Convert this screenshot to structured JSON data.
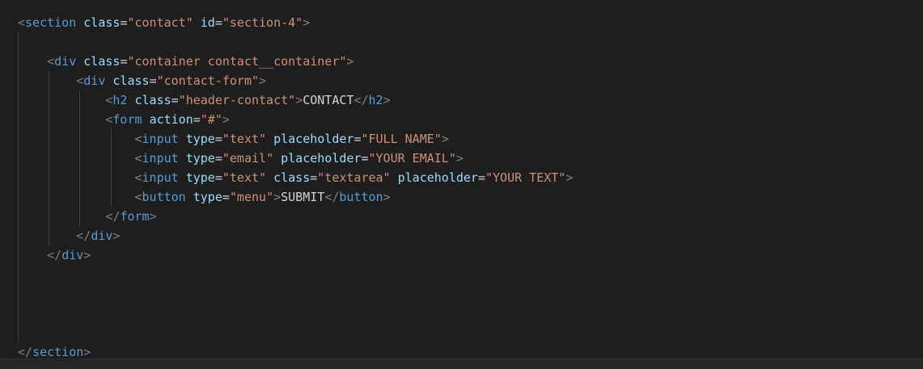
{
  "editor": {
    "lines": [
      [
        {
          "text": "<",
          "type": "punct"
        },
        {
          "text": "section",
          "type": "tag"
        },
        {
          "text": " ",
          "type": "text"
        },
        {
          "text": "class",
          "type": "attr"
        },
        {
          "text": "=",
          "type": "eq"
        },
        {
          "text": "\"contact\"",
          "type": "str"
        },
        {
          "text": " ",
          "type": "text"
        },
        {
          "text": "id",
          "type": "attr"
        },
        {
          "text": "=",
          "type": "eq"
        },
        {
          "text": "\"section-4\"",
          "type": "str"
        },
        {
          "text": ">",
          "type": "punct"
        }
      ],
      [],
      [
        {
          "text": "    ",
          "type": "text"
        },
        {
          "text": "<",
          "type": "punct"
        },
        {
          "text": "div",
          "type": "tag"
        },
        {
          "text": " ",
          "type": "text"
        },
        {
          "text": "class",
          "type": "attr"
        },
        {
          "text": "=",
          "type": "eq"
        },
        {
          "text": "\"container contact__container\"",
          "type": "str"
        },
        {
          "text": ">",
          "type": "punct"
        }
      ],
      [
        {
          "text": "        ",
          "type": "text"
        },
        {
          "text": "<",
          "type": "punct"
        },
        {
          "text": "div",
          "type": "tag"
        },
        {
          "text": " ",
          "type": "text"
        },
        {
          "text": "class",
          "type": "attr"
        },
        {
          "text": "=",
          "type": "eq"
        },
        {
          "text": "\"contact-form\"",
          "type": "str"
        },
        {
          "text": ">",
          "type": "punct"
        }
      ],
      [
        {
          "text": "            ",
          "type": "text"
        },
        {
          "text": "<",
          "type": "punct"
        },
        {
          "text": "h2",
          "type": "tag"
        },
        {
          "text": " ",
          "type": "text"
        },
        {
          "text": "class",
          "type": "attr"
        },
        {
          "text": "=",
          "type": "eq"
        },
        {
          "text": "\"header-contact\"",
          "type": "str"
        },
        {
          "text": ">",
          "type": "punct"
        },
        {
          "text": "CONTACT",
          "type": "text"
        },
        {
          "text": "</",
          "type": "punct"
        },
        {
          "text": "h2",
          "type": "tag"
        },
        {
          "text": ">",
          "type": "punct"
        }
      ],
      [
        {
          "text": "            ",
          "type": "text"
        },
        {
          "text": "<",
          "type": "punct"
        },
        {
          "text": "form",
          "type": "tag"
        },
        {
          "text": " ",
          "type": "text"
        },
        {
          "text": "action",
          "type": "attr"
        },
        {
          "text": "=",
          "type": "eq"
        },
        {
          "text": "\"#\"",
          "type": "str"
        },
        {
          "text": ">",
          "type": "punct"
        }
      ],
      [
        {
          "text": "                ",
          "type": "text"
        },
        {
          "text": "<",
          "type": "punct"
        },
        {
          "text": "input",
          "type": "tag"
        },
        {
          "text": " ",
          "type": "text"
        },
        {
          "text": "type",
          "type": "attr"
        },
        {
          "text": "=",
          "type": "eq"
        },
        {
          "text": "\"text\"",
          "type": "str"
        },
        {
          "text": " ",
          "type": "text"
        },
        {
          "text": "placeholder",
          "type": "attr"
        },
        {
          "text": "=",
          "type": "eq"
        },
        {
          "text": "\"FULL NAME\"",
          "type": "str"
        },
        {
          "text": ">",
          "type": "punct"
        }
      ],
      [
        {
          "text": "                ",
          "type": "text"
        },
        {
          "text": "<",
          "type": "punct"
        },
        {
          "text": "input",
          "type": "tag"
        },
        {
          "text": " ",
          "type": "text"
        },
        {
          "text": "type",
          "type": "attr"
        },
        {
          "text": "=",
          "type": "eq"
        },
        {
          "text": "\"email\"",
          "type": "str"
        },
        {
          "text": " ",
          "type": "text"
        },
        {
          "text": "placeholder",
          "type": "attr"
        },
        {
          "text": "=",
          "type": "eq"
        },
        {
          "text": "\"YOUR EMAIL\"",
          "type": "str"
        },
        {
          "text": ">",
          "type": "punct"
        }
      ],
      [
        {
          "text": "                ",
          "type": "text"
        },
        {
          "text": "<",
          "type": "punct"
        },
        {
          "text": "input",
          "type": "tag"
        },
        {
          "text": " ",
          "type": "text"
        },
        {
          "text": "type",
          "type": "attr"
        },
        {
          "text": "=",
          "type": "eq"
        },
        {
          "text": "\"text\"",
          "type": "str"
        },
        {
          "text": " ",
          "type": "text"
        },
        {
          "text": "class",
          "type": "attr"
        },
        {
          "text": "=",
          "type": "eq"
        },
        {
          "text": "\"textarea\"",
          "type": "str"
        },
        {
          "text": " ",
          "type": "text"
        },
        {
          "text": "placeholder",
          "type": "attr"
        },
        {
          "text": "=",
          "type": "eq"
        },
        {
          "text": "\"YOUR TEXT\"",
          "type": "str"
        },
        {
          "text": ">",
          "type": "punct"
        }
      ],
      [
        {
          "text": "                ",
          "type": "text"
        },
        {
          "text": "<",
          "type": "punct"
        },
        {
          "text": "button",
          "type": "tag"
        },
        {
          "text": " ",
          "type": "text"
        },
        {
          "text": "type",
          "type": "attr"
        },
        {
          "text": "=",
          "type": "eq"
        },
        {
          "text": "\"menu\"",
          "type": "str"
        },
        {
          "text": ">",
          "type": "punct"
        },
        {
          "text": "SUBMIT",
          "type": "text"
        },
        {
          "text": "</",
          "type": "punct"
        },
        {
          "text": "button",
          "type": "tag"
        },
        {
          "text": ">",
          "type": "punct"
        }
      ],
      [
        {
          "text": "            ",
          "type": "text"
        },
        {
          "text": "</",
          "type": "punct"
        },
        {
          "text": "form",
          "type": "tag"
        },
        {
          "text": ">",
          "type": "punct"
        }
      ],
      [
        {
          "text": "        ",
          "type": "text"
        },
        {
          "text": "</",
          "type": "punct"
        },
        {
          "text": "div",
          "type": "tag"
        },
        {
          "text": ">",
          "type": "punct"
        }
      ],
      [
        {
          "text": "    ",
          "type": "text"
        },
        {
          "text": "</",
          "type": "punct"
        },
        {
          "text": "div",
          "type": "tag"
        },
        {
          "text": ">",
          "type": "punct"
        }
      ],
      [],
      [],
      [],
      [],
      [
        {
          "text": "</",
          "type": "punct"
        },
        {
          "text": "section",
          "type": "tag"
        },
        {
          "text": ">",
          "type": "punct"
        }
      ]
    ]
  },
  "theme": {
    "background": "#1e1e1e",
    "tag_color": "#569cd6",
    "attribute_color": "#9cdcfe",
    "string_color": "#ce9178",
    "bracket_color": "#808080",
    "text_color": "#d4d4d4"
  }
}
